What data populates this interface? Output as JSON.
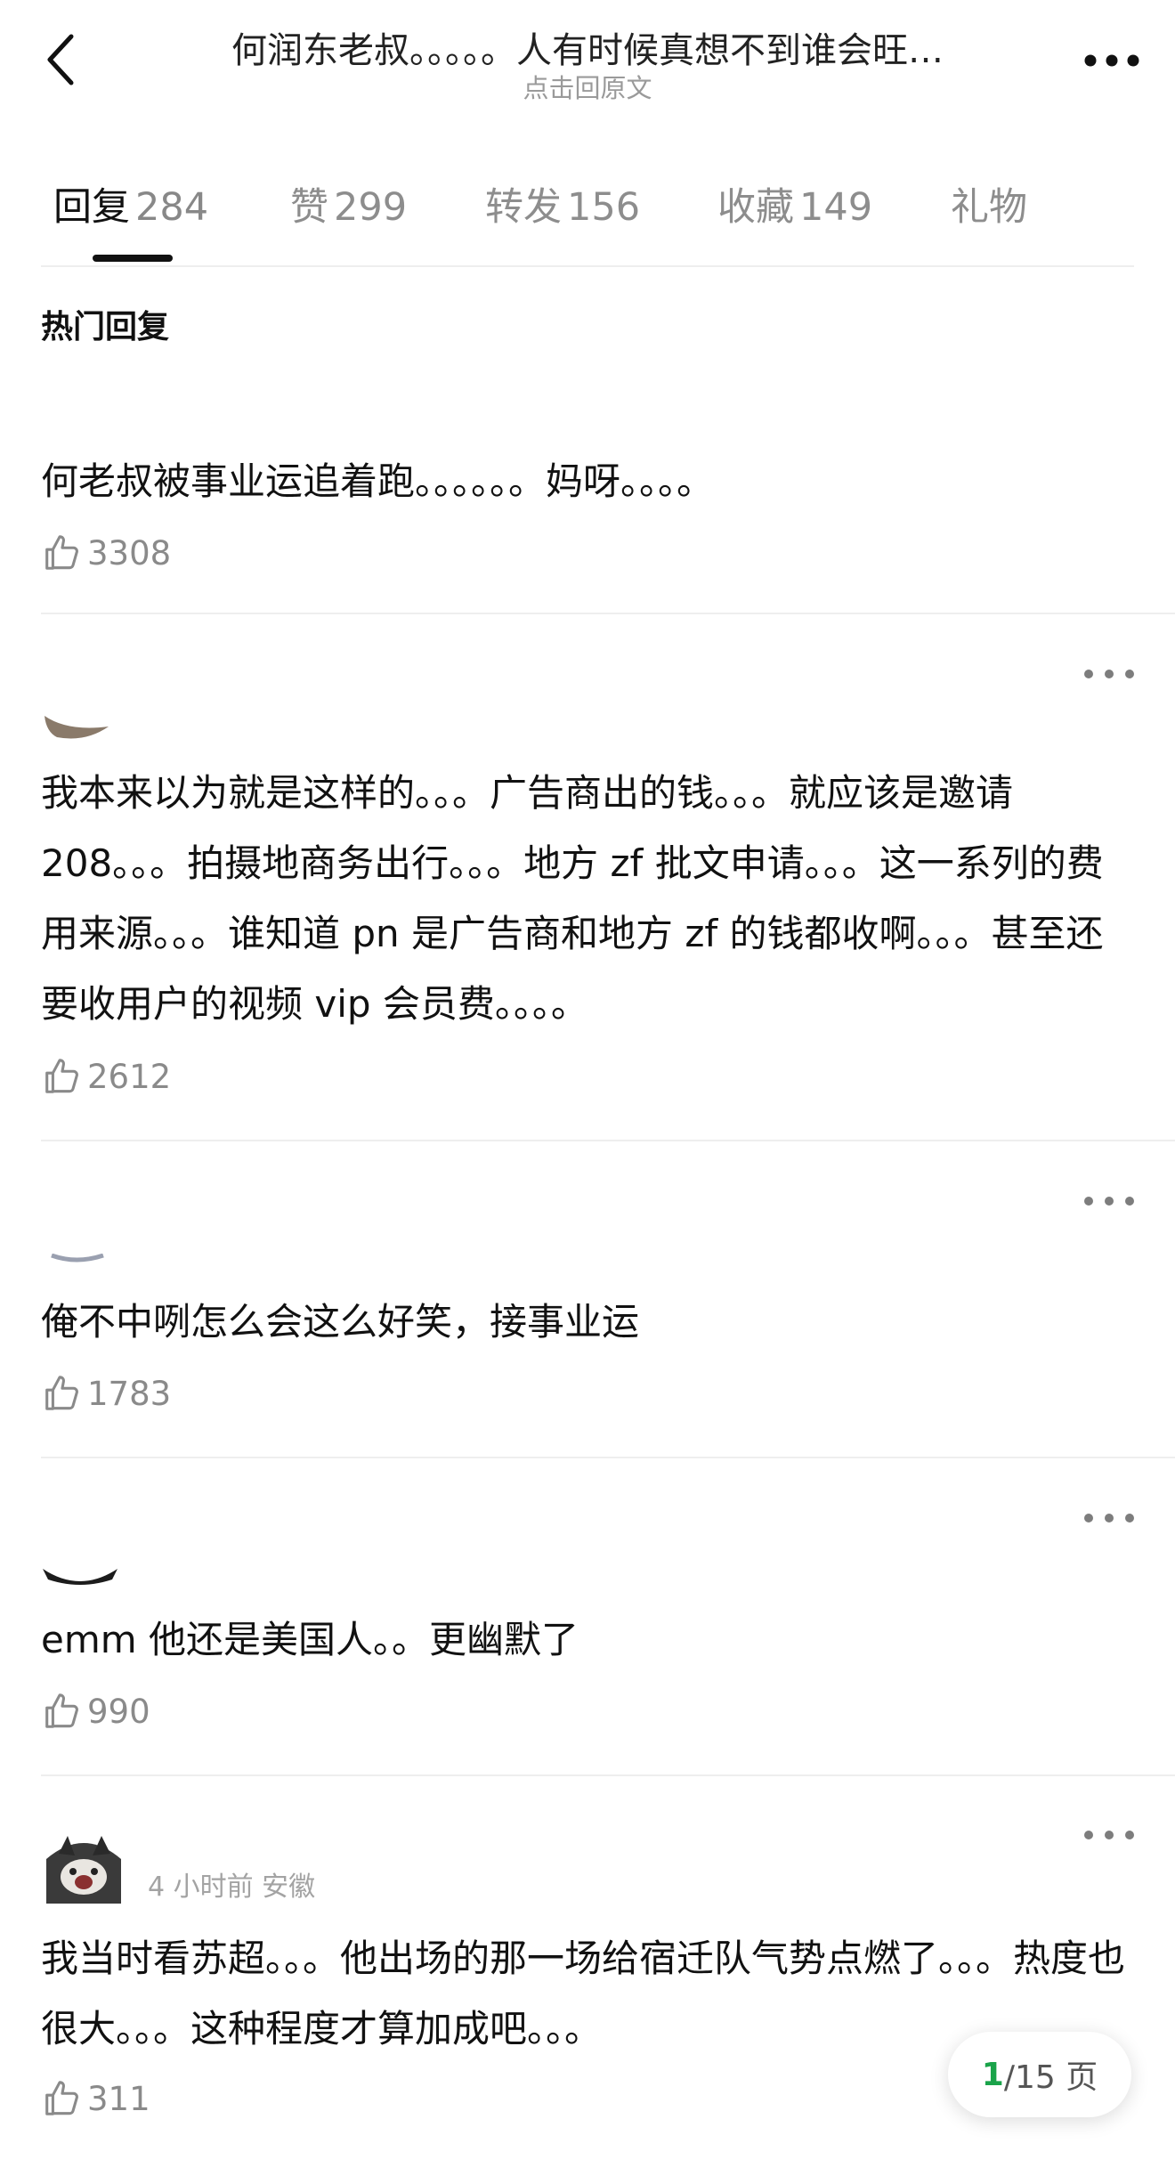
{
  "header": {
    "title": "何润东老叔。。。。。人有时候真想不到谁会旺…",
    "subtitle": "点击回原文"
  },
  "tabs": [
    {
      "label": "回复",
      "count": "284",
      "active": true
    },
    {
      "label": "赞",
      "count": "299"
    },
    {
      "label": "转发",
      "count": "156"
    },
    {
      "label": "收藏",
      "count": "149"
    },
    {
      "label": "礼物",
      "count": ""
    }
  ],
  "section_label": "热门回复",
  "comments": [
    {
      "text": "何老叔被事业运追着跑。。。。。。妈呀。。。。",
      "likes": "3308"
    },
    {
      "text": "我本来以为就是这样的。。。广告商出的钱。。。就应该是邀请208。。。拍摄地商务出行。。。地方 zf 批文申请。。。这一系列的费用来源。。。谁知道 pn 是广告商和地方 zf 的钱都收啊。。。甚至还要收用户的视频 vip 会员费。。。。",
      "likes": "2612"
    },
    {
      "text": "俺不中咧怎么会这么好笑，接事业运",
      "likes": "1783"
    },
    {
      "text": "emm 他还是美国人。。更幽默了",
      "likes": "990"
    },
    {
      "meta": "4 小时前 安徽",
      "text": "我当时看苏超。。。他出场的那一场给宿迁队气势点燃了。。。热度也很大。。。这种程度才算加成吧。。。",
      "likes": "311"
    }
  ],
  "pager": {
    "current": "1",
    "total_text": "/15 页"
  },
  "icons": {
    "back": "chevron-left-icon",
    "more": "more-icon",
    "like": "thumbs-up-icon",
    "comment_more": "more-dots-icon"
  },
  "colors": {
    "accent_green": "#1aa34a",
    "text": "#111111",
    "muted": "#8a8a8a",
    "divider": "#eeeeee"
  }
}
